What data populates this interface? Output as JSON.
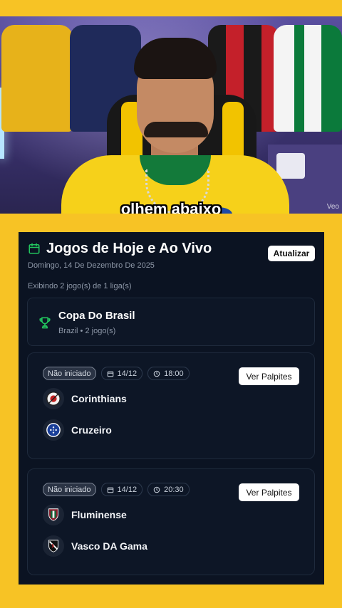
{
  "video": {
    "caption": "olhem abaixo",
    "watermark": "Veo"
  },
  "panel": {
    "title": "Jogos de Hoje e Ao Vivo",
    "refresh_label": "Atualizar",
    "date": "Domingo, 14 De Dezembro De 2025",
    "showing": "Exibindo 2 jogo(s) de 1 liga(s)",
    "accent_color": "#22c55e",
    "league": {
      "name": "Copa Do Brasil",
      "meta": "Brazil • 2 jogo(s)",
      "icon": "trophy-icon"
    },
    "matches": [
      {
        "status": "Não iniciado",
        "date": "14/12",
        "time": "18:00",
        "action": "Ver Palpites",
        "home": "Corinthians",
        "away": "Cruzeiro"
      },
      {
        "status": "Não iniciado",
        "date": "14/12",
        "time": "20:30",
        "action": "Ver Palpites",
        "home": "Fluminense",
        "away": "Vasco DA Gama"
      }
    ]
  }
}
